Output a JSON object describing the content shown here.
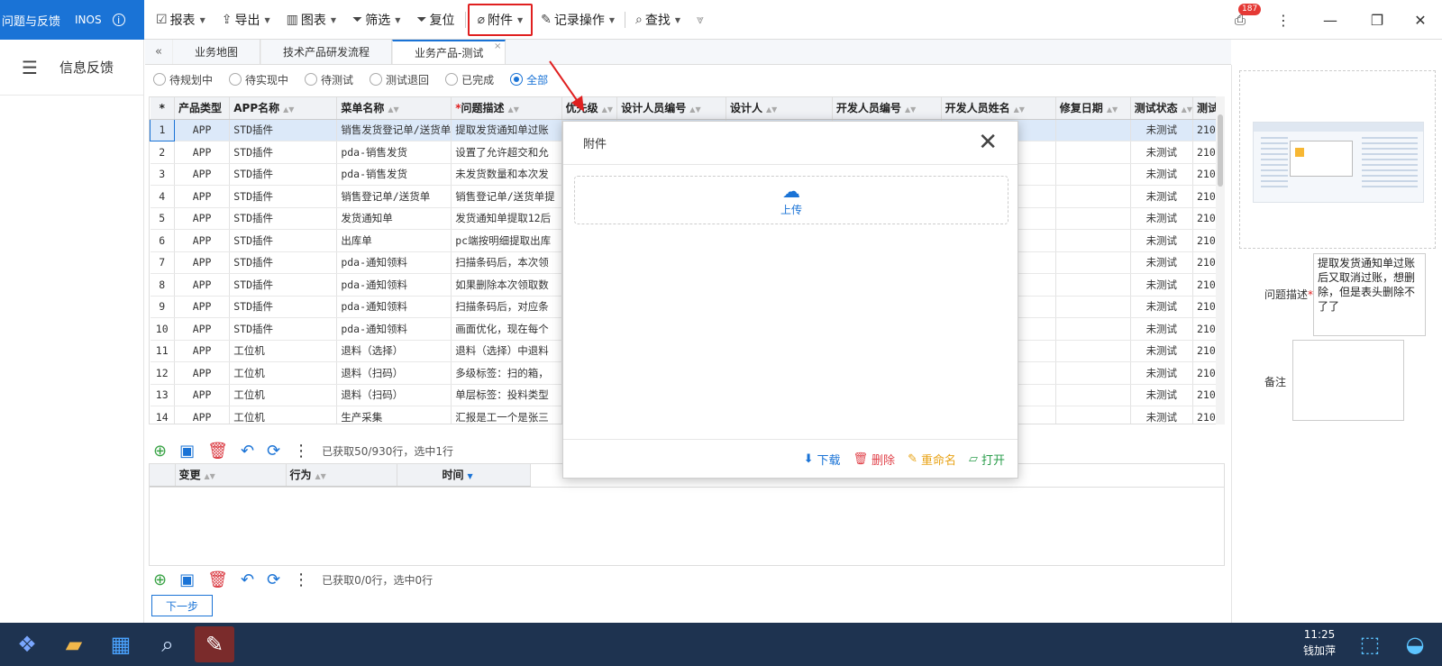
{
  "brand": {
    "title": "问题与反馈",
    "sub": "INOS",
    "info": "i"
  },
  "toolbar": [
    {
      "key": "report",
      "icon": "☑",
      "label": "报表",
      "caret": true
    },
    {
      "key": "export",
      "icon": "⇪",
      "label": "导出",
      "caret": true
    },
    {
      "key": "chart",
      "icon": "▥",
      "label": "图表",
      "caret": true
    },
    {
      "key": "filter",
      "icon": "⏷",
      "label": "筛选",
      "caret": true
    },
    {
      "key": "reset",
      "icon": "⏷",
      "label": "复位",
      "caret": false
    },
    {
      "key": "attach",
      "icon": "⌀",
      "label": "附件",
      "caret": true,
      "active": true
    },
    {
      "key": "records",
      "icon": "✎",
      "label": "记录操作",
      "caret": true
    },
    {
      "key": "find",
      "icon": "⌕",
      "label": "查找",
      "caret": true
    }
  ],
  "notifications": {
    "count": "187"
  },
  "sidebar": {
    "label": "信息反馈"
  },
  "tabs": {
    "items": [
      "业务地图",
      "技术产品研发流程",
      "业务产品-测试"
    ],
    "active_index": 2
  },
  "filters": {
    "items": [
      "待规划中",
      "待实现中",
      "待测试",
      "测试退回",
      "已完成",
      "全部"
    ],
    "selected_index": 5
  },
  "grid": {
    "columns": [
      "*",
      "产品类型",
      "APP名称",
      "菜单名称",
      "问题描述",
      "优先级",
      "设计人员编号",
      "设计人",
      "开发人员编号",
      "开发人员姓名",
      "修复日期",
      "测试状态",
      "测试"
    ],
    "rows": [
      [
        "1",
        "APP",
        "STD插件",
        "销售发货登记单/送货单",
        "提取发货通知单过账",
        "",
        "",
        "",
        "",
        "",
        "",
        "未测试",
        "210"
      ],
      [
        "2",
        "APP",
        "STD插件",
        "pda-销售发货",
        "设置了允许超交和允",
        "",
        "",
        "",
        "",
        "",
        "",
        "未测试",
        "210"
      ],
      [
        "3",
        "APP",
        "STD插件",
        "pda-销售发货",
        "未发货数量和本次发",
        "",
        "",
        "",
        "",
        "",
        "",
        "未测试",
        "210"
      ],
      [
        "4",
        "APP",
        "STD插件",
        "销售登记单/送货单",
        "销售登记单/送货单提",
        "",
        "",
        "",
        "",
        "",
        "",
        "未测试",
        "210"
      ],
      [
        "5",
        "APP",
        "STD插件",
        "发货通知单",
        "发货通知单提取12后",
        "",
        "",
        "",
        "",
        "",
        "",
        "未测试",
        "210"
      ],
      [
        "6",
        "APP",
        "STD插件",
        "出库单",
        "pc端按明细提取出库",
        "",
        "",
        "",
        "",
        "",
        "",
        "未测试",
        "210"
      ],
      [
        "7",
        "APP",
        "STD插件",
        "pda-通知领料",
        "扫描条码后，本次领",
        "",
        "",
        "",
        "",
        "",
        "",
        "未测试",
        "210"
      ],
      [
        "8",
        "APP",
        "STD插件",
        "pda-通知领料",
        "如果删除本次领取数",
        "",
        "",
        "",
        "",
        "",
        "",
        "未测试",
        "210"
      ],
      [
        "9",
        "APP",
        "STD插件",
        "pda-通知领料",
        "扫描条码后，对应条",
        "",
        "",
        "",
        "",
        "",
        "",
        "未测试",
        "210"
      ],
      [
        "10",
        "APP",
        "STD插件",
        "pda-通知领料",
        "画面优化，现在每个",
        "",
        "",
        "",
        "",
        "",
        "",
        "未测试",
        "210"
      ],
      [
        "11",
        "APP",
        "工位机",
        "退料（选择）",
        "退料（选择）中退料",
        "",
        "",
        "",
        "",
        "",
        "",
        "未测试",
        "210"
      ],
      [
        "12",
        "APP",
        "工位机",
        "退料（扫码）",
        "多级标签：扫的箱，",
        "",
        "",
        "",
        "",
        "",
        "",
        "未测试",
        "210"
      ],
      [
        "13",
        "APP",
        "工位机",
        "退料（扫码）",
        "单层标签：投料类型",
        "",
        "",
        "",
        "",
        "",
        "",
        "未测试",
        "210"
      ],
      [
        "14",
        "APP",
        "工位机",
        "生产采集",
        "汇报是工一个是张三",
        "",
        "",
        "",
        "",
        "",
        "",
        "未测试",
        "210"
      ]
    ],
    "status": "已获取50/930行，选中1行"
  },
  "subgrid": {
    "columns": [
      "变更",
      "行为",
      "时间"
    ],
    "status": "已获取0/0行，选中0行"
  },
  "next_button": "下一步",
  "right_panel": {
    "desc_label": "问题描述",
    "desc_value": "提取发货通知单过账后又取消过账，想删除，但是表头删除不了了",
    "note_label": "备注"
  },
  "modal": {
    "title": "附件",
    "upload": "上传",
    "actions": [
      {
        "key": "download",
        "label": "下载",
        "color": "#1a73d6",
        "icon": "⬇"
      },
      {
        "key": "delete",
        "label": "删除",
        "color": "#e0424a",
        "icon": "🗑"
      },
      {
        "key": "rename",
        "label": "重命名",
        "color": "#e8a317",
        "icon": "✎"
      },
      {
        "key": "open",
        "label": "打开",
        "color": "#2a9d4b",
        "icon": "▱"
      }
    ]
  },
  "taskbar": {
    "time": "11:25",
    "user": "钱加萍"
  },
  "colors": {
    "brand": "#1a73d6",
    "highlight": "#e02020",
    "taskbar": "#1e3350"
  }
}
